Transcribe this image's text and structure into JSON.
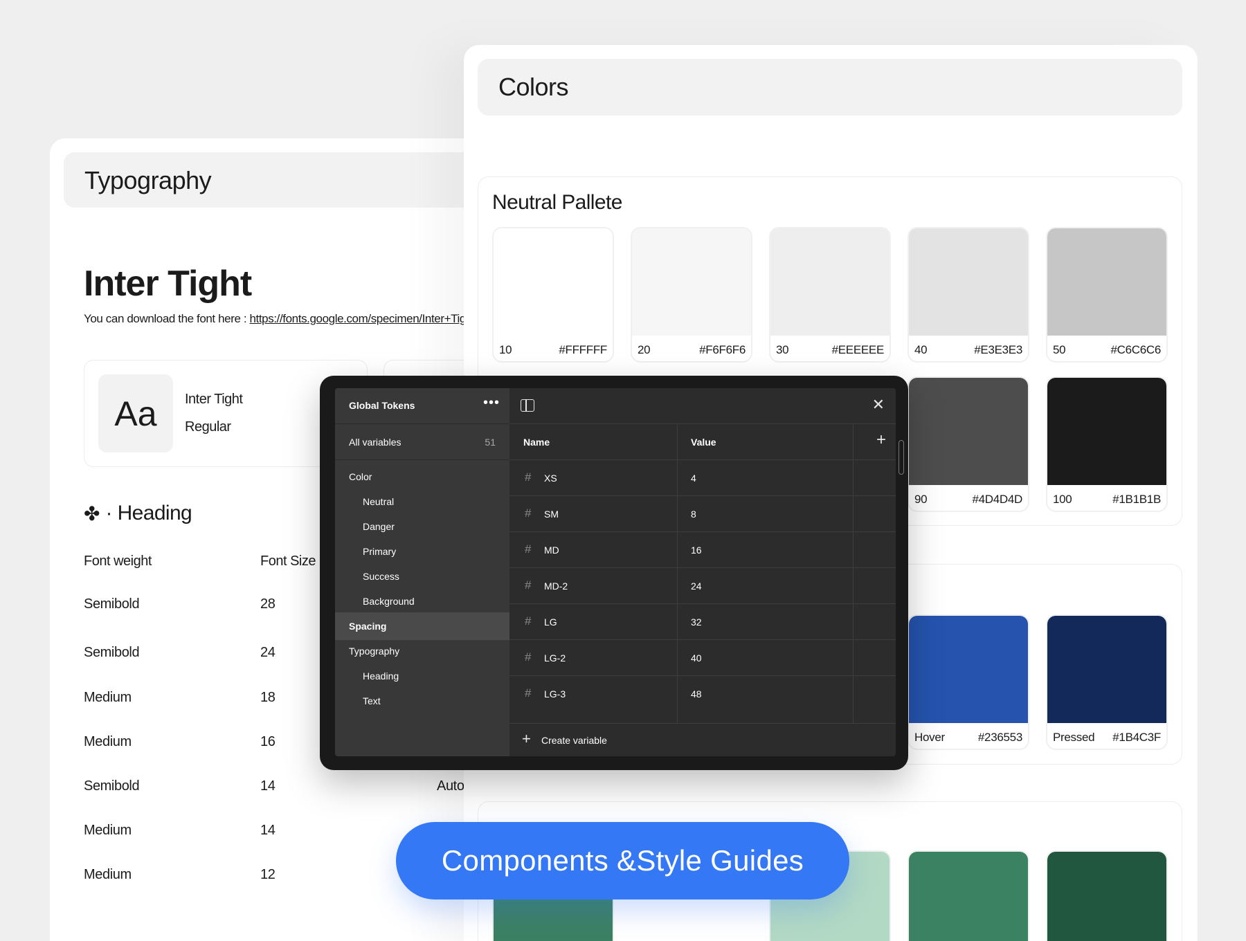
{
  "typography": {
    "section_title": "Typography",
    "font_name": "Inter Tight",
    "download_prefix": "You can download the font here : ",
    "download_link": "https://fonts.google.com/specimen/Inter+Tight",
    "sample": {
      "glyph": "Aa",
      "name": "Inter Tight",
      "style": "Regular"
    },
    "heading_label": "· Heading",
    "columns": {
      "weight": "Font weight",
      "size": "Font Size"
    },
    "rows": [
      {
        "weight": "Semibold",
        "size": "28",
        "line_height": ""
      },
      {
        "weight": "Semibold",
        "size": "24",
        "line_height": ""
      },
      {
        "weight": "Medium",
        "size": "18",
        "line_height": ""
      },
      {
        "weight": "Medium",
        "size": "16",
        "line_height": ""
      },
      {
        "weight": "Semibold",
        "size": "14",
        "line_height": "Auto"
      },
      {
        "weight": "Medium",
        "size": "14",
        "line_height": ""
      },
      {
        "weight": "Medium",
        "size": "12",
        "line_height": ""
      }
    ]
  },
  "colors": {
    "section_title": "Colors",
    "neutral": {
      "title": "Neutral Pallete",
      "swatches": [
        {
          "step": "10",
          "hex": "#FFFFFF",
          "color": "#FFFFFF"
        },
        {
          "step": "20",
          "hex": "#F6F6F6",
          "color": "#F6F6F6"
        },
        {
          "step": "30",
          "hex": "#EEEEEE",
          "color": "#EEEEEE"
        },
        {
          "step": "40",
          "hex": "#E3E3E3",
          "color": "#E3E3E3"
        },
        {
          "step": "50",
          "hex": "#C6C6C6",
          "color": "#C6C6C6"
        },
        {
          "step": "90",
          "hex": "#4D4D4D",
          "color": "#4D4D4D"
        },
        {
          "step": "100",
          "hex": "#1B1B1B",
          "color": "#1B1B1B"
        }
      ]
    },
    "primary": {
      "swatches": [
        {
          "step": "Hover",
          "hex": "#236553",
          "color": "#2553AE"
        },
        {
          "step": "Pressed",
          "hex": "#1B4C3F",
          "color": "#13295A"
        }
      ]
    },
    "success": {
      "colors": [
        "#3C8063",
        "#B2D9C4",
        "#3A8262",
        "#21573F"
      ]
    }
  },
  "variables_panel": {
    "collection_title": "Global Tokens",
    "all_variables_label": "All variables",
    "all_variables_count": "51",
    "groups": [
      {
        "label": "Color",
        "level": 0,
        "selected": false
      },
      {
        "label": "Neutral",
        "level": 1,
        "selected": false
      },
      {
        "label": "Danger",
        "level": 1,
        "selected": false
      },
      {
        "label": "Primary",
        "level": 1,
        "selected": false
      },
      {
        "label": "Success",
        "level": 1,
        "selected": false
      },
      {
        "label": "Background",
        "level": 1,
        "selected": false
      },
      {
        "label": "Spacing",
        "level": 0,
        "selected": true
      },
      {
        "label": "Typography",
        "level": 0,
        "selected": false
      },
      {
        "label": "Heading",
        "level": 1,
        "selected": false
      },
      {
        "label": "Text",
        "level": 1,
        "selected": false
      }
    ],
    "columns": {
      "name": "Name",
      "value": "Value"
    },
    "variables": [
      {
        "name": "XS",
        "value": "4"
      },
      {
        "name": "SM",
        "value": "8"
      },
      {
        "name": "MD",
        "value": "16"
      },
      {
        "name": "MD-2",
        "value": "24"
      },
      {
        "name": "LG",
        "value": "32"
      },
      {
        "name": "LG-2",
        "value": "40"
      },
      {
        "name": "LG-3",
        "value": "48"
      }
    ],
    "create_label": "Create variable"
  },
  "banner": {
    "label": "Components &Style Guides",
    "color": "#3478F6"
  }
}
